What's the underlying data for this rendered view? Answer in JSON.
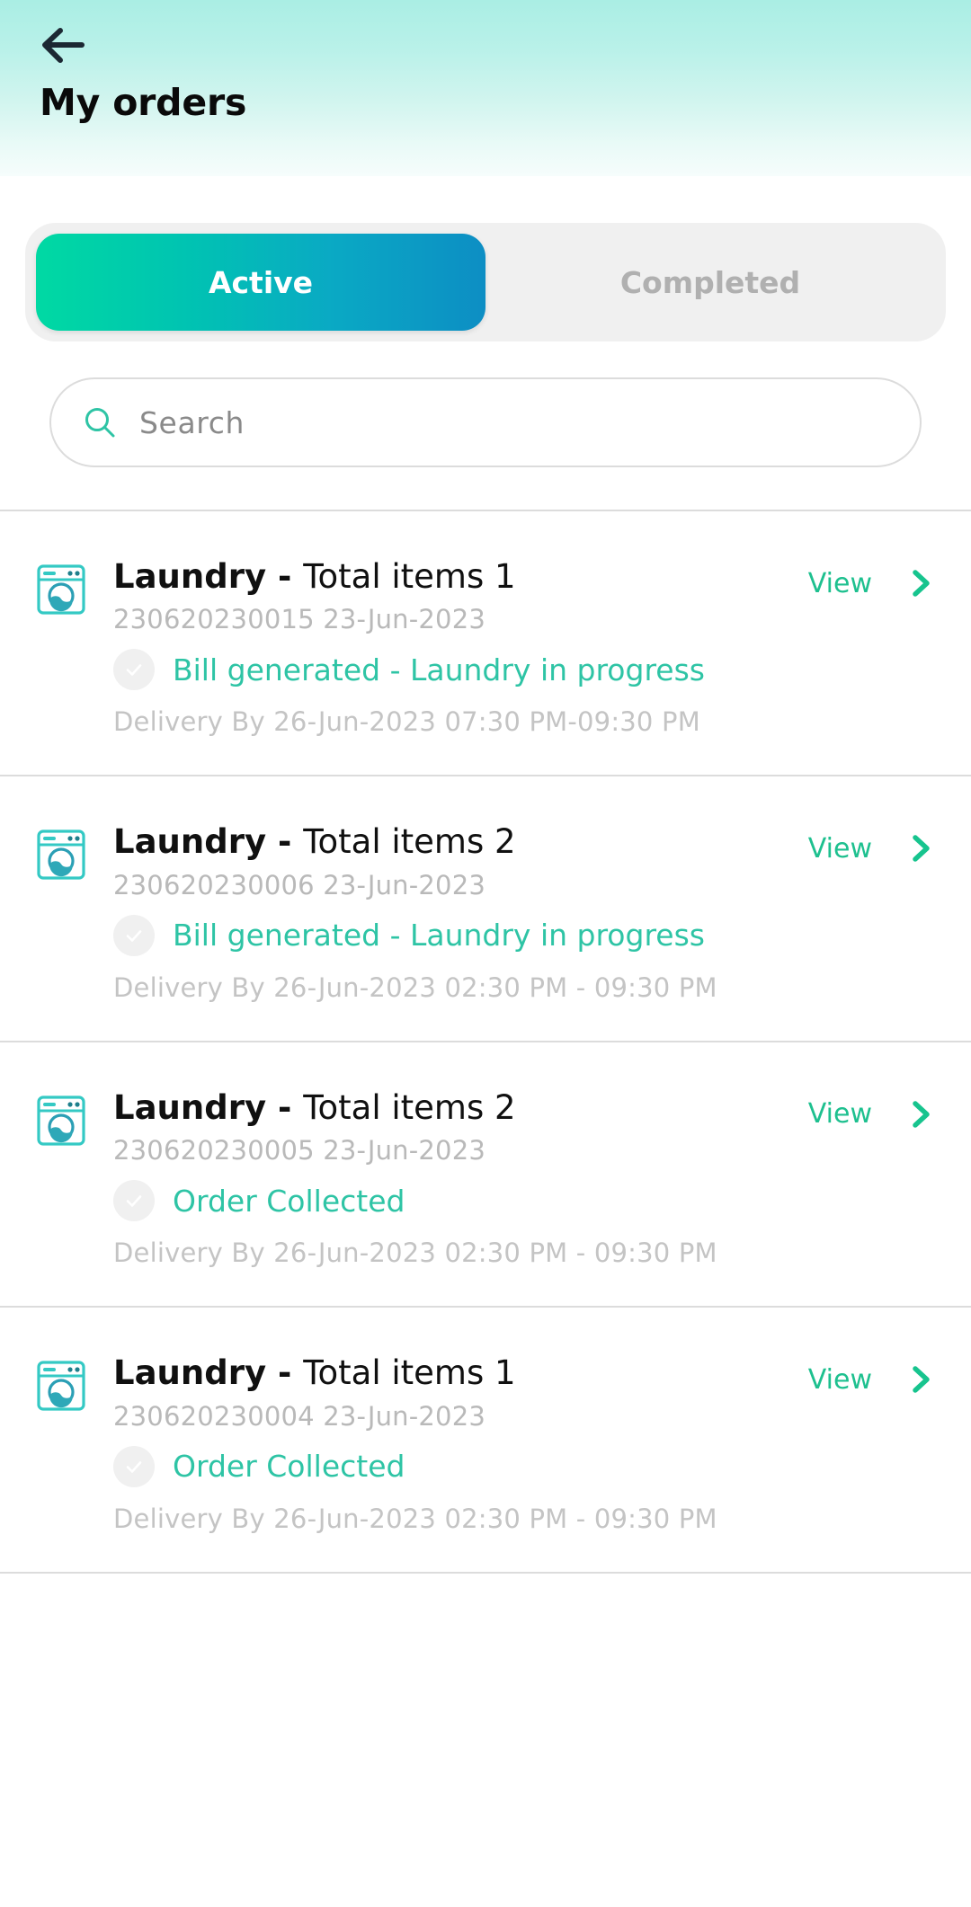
{
  "header": {
    "back_icon": "arrow-left-icon",
    "title": "My orders",
    "gradient_top": "#aaeee4",
    "gradient_bottom": "#f6fdfc"
  },
  "tabs": {
    "active_index": 0,
    "items": [
      {
        "label": "Active"
      },
      {
        "label": "Completed"
      }
    ],
    "active_gradient_from": "#00d9a3",
    "active_gradient_to": "#0d8ec4",
    "inactive_color": "#b0b0b0",
    "track_color": "#f0f0f0"
  },
  "search": {
    "icon": "search-icon",
    "value": "",
    "placeholder": "Search",
    "icon_color": "#2ec4a5"
  },
  "list": {
    "view_label": "View",
    "chevron_icon": "chevron-right-icon",
    "status_icon": "check-circle-icon",
    "accent_color": "#2ec4a5",
    "orders": [
      {
        "icon": "washing-machine-icon",
        "service": "Laundry - ",
        "items_label": "Total items 1",
        "order_id": "230620230015",
        "order_date": "23-Jun-2023",
        "status": "Bill generated - Laundry in progress",
        "delivery": "Delivery By 26-Jun-2023 07:30 PM-09:30 PM",
        "action_label": "View"
      },
      {
        "icon": "washing-machine-icon",
        "service": "Laundry - ",
        "items_label": "Total items 2",
        "order_id": "230620230006",
        "order_date": "23-Jun-2023",
        "status": "Bill generated - Laundry in progress",
        "delivery": "Delivery By 26-Jun-2023 02:30 PM - 09:30 PM",
        "action_label": "View"
      },
      {
        "icon": "washing-machine-icon",
        "service": "Laundry - ",
        "items_label": "Total items 2",
        "order_id": "230620230005",
        "order_date": "23-Jun-2023",
        "status": "Order Collected",
        "delivery": "Delivery By 26-Jun-2023 02:30 PM - 09:30 PM",
        "action_label": "View"
      },
      {
        "icon": "washing-machine-icon",
        "service": "Laundry - ",
        "items_label": "Total items 1",
        "order_id": "230620230004",
        "order_date": "23-Jun-2023",
        "status": "Order Collected",
        "delivery": "Delivery By 26-Jun-2023 02:30 PM - 09:30 PM",
        "action_label": "View"
      }
    ]
  }
}
